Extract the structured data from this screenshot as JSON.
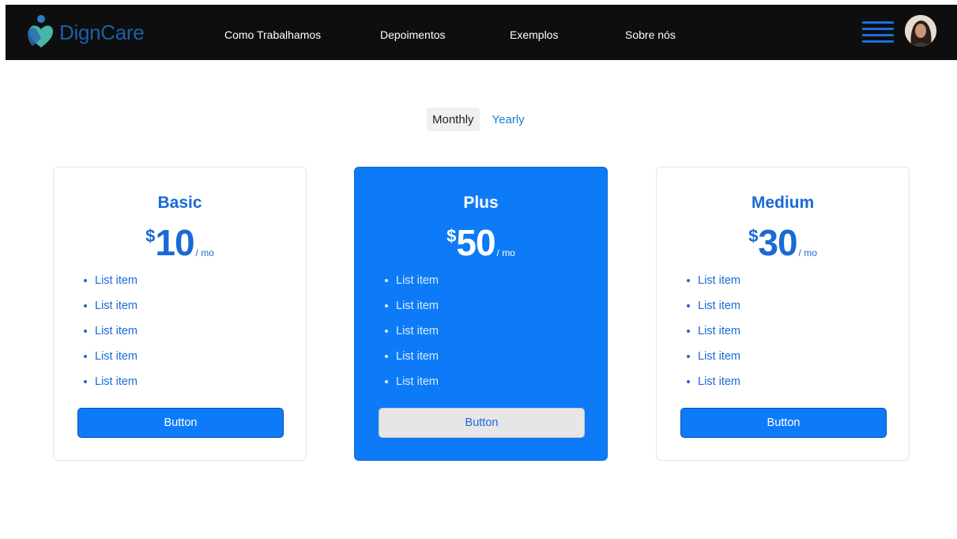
{
  "header": {
    "brand": "DignCare",
    "nav": [
      "Como Trabalhamos",
      "Depoimentos",
      "Exemplos",
      "Sobre nós"
    ]
  },
  "billing_toggle": {
    "options": [
      "Monthly",
      "Yearly"
    ],
    "selected": "Monthly"
  },
  "plans": [
    {
      "name": "Basic",
      "currency": "$",
      "price": "10",
      "period": "/ mo",
      "features": [
        "List item",
        "List item",
        "List item",
        "List item",
        "List item"
      ],
      "button": "Button",
      "featured": false
    },
    {
      "name": "Plus",
      "currency": "$",
      "price": "50",
      "period": "/ mo",
      "features": [
        "List item",
        "List item",
        "List item",
        "List item",
        "List item"
      ],
      "button": "Button",
      "featured": true
    },
    {
      "name": "Medium",
      "currency": "$",
      "price": "30",
      "period": "/ mo",
      "features": [
        "List item",
        "List item",
        "List item",
        "List item",
        "List item"
      ],
      "button": "Button",
      "featured": false
    }
  ],
  "icons": {
    "logo": "heart-person-logo-icon",
    "menu": "hamburger-menu-icon",
    "avatar": "user-avatar"
  },
  "colors": {
    "accent": "#0d7bf7",
    "navbar": "#0e0e0e",
    "brand": "#1b5fa8",
    "logo_green": "#47b6a5"
  }
}
